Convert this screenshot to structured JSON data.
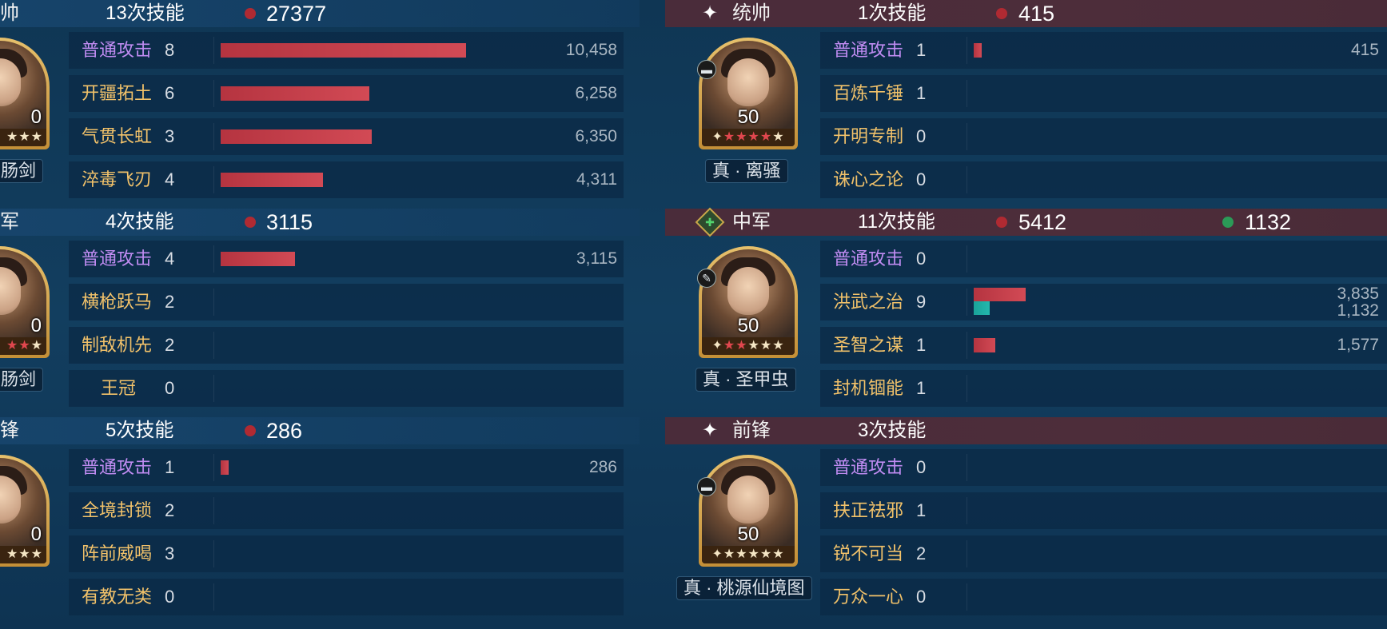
{
  "colors": {
    "damage": "#b53440",
    "heal": "#1aa49a",
    "damage_dot": "#b02a32",
    "heal_dot": "#2b9a57",
    "normal_skill": "#c08cf2",
    "skill": "#f2c26a"
  },
  "left": {
    "panels": [
      {
        "role": "帅",
        "skill_count": "13次技能",
        "damage": "27377",
        "level": "0",
        "item": "鱼肠剑",
        "skills": [
          {
            "name": "普通攻击",
            "count": "8",
            "value": "10,458",
            "bar": 0.53,
            "normal": true
          },
          {
            "name": "开疆拓土",
            "count": "6",
            "value": "6,258",
            "bar": 0.32
          },
          {
            "name": "气贯长虹",
            "count": "3",
            "value": "6,350",
            "bar": 0.325
          },
          {
            "name": "淬毒飞刃",
            "count": "4",
            "value": "4,311",
            "bar": 0.22
          }
        ]
      },
      {
        "role": "军",
        "skill_count": "4次技能",
        "damage": "3115",
        "level": "0",
        "item": "鱼肠剑",
        "skills": [
          {
            "name": "普通攻击",
            "count": "4",
            "value": "3,115",
            "bar": 0.16,
            "normal": true
          },
          {
            "name": "横枪跃马",
            "count": "2"
          },
          {
            "name": "制敌机先",
            "count": "2"
          },
          {
            "name": "王冠",
            "count": "0"
          }
        ]
      },
      {
        "role": "锋",
        "skill_count": "5次技能",
        "damage": "286",
        "level": "0",
        "skills": [
          {
            "name": "普通攻击",
            "count": "1",
            "value": "286",
            "bar": 0.015,
            "normal": true
          },
          {
            "name": "全境封锁",
            "count": "2"
          },
          {
            "name": "阵前威喝",
            "count": "3"
          },
          {
            "name": "有教无类",
            "count": "0"
          }
        ]
      }
    ]
  },
  "right": {
    "panels": [
      {
        "role_icon": "✦",
        "role": "统帅",
        "skill_count": "1次技能",
        "damage": "415",
        "level": "50",
        "item": "真 · 离骚",
        "type_icon": "▬",
        "skills": [
          {
            "name": "普通攻击",
            "count": "1",
            "value": "415",
            "bar": 0.012,
            "normal": true
          },
          {
            "name": "百炼千锤",
            "count": "1"
          },
          {
            "name": "开明专制",
            "count": "0"
          },
          {
            "name": "诛心之论",
            "count": "0"
          }
        ]
      },
      {
        "role_icon": "✚",
        "role": "中军",
        "skill_count": "11次技能",
        "damage": "5412",
        "heal": "1132",
        "level": "50",
        "item": "真 · 圣甲虫",
        "type_icon": "✎",
        "skills": [
          {
            "name": "普通攻击",
            "count": "0",
            "normal": true
          },
          {
            "name": "洪武之治",
            "count": "9",
            "value": "3,835",
            "value2": "1,132",
            "bar": 0.112,
            "bar2": 0.034
          },
          {
            "name": "圣智之谋",
            "count": "1",
            "value": "1,577",
            "bar": 0.047
          },
          {
            "name": "封机锢能",
            "count": "1"
          }
        ]
      },
      {
        "role_icon": "✦",
        "role": "前锋",
        "skill_count": "3次技能",
        "level": "50",
        "item": "真 · 桃源仙境图",
        "type_icon": "▬",
        "skills": [
          {
            "name": "普通攻击",
            "count": "0",
            "normal": true
          },
          {
            "name": "扶正祛邪",
            "count": "1"
          },
          {
            "name": "锐不可当",
            "count": "2"
          },
          {
            "name": "万众一心",
            "count": "0"
          }
        ]
      }
    ]
  }
}
